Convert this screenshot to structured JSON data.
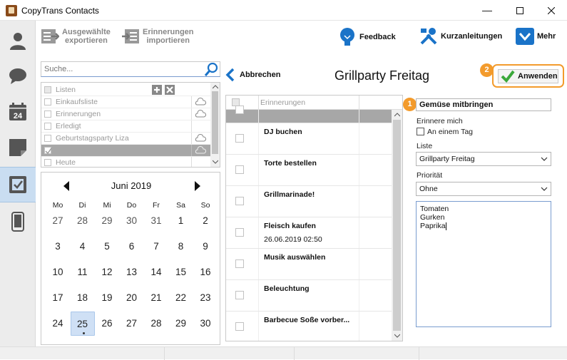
{
  "window": {
    "title": "CopyTrans Contacts",
    "controls": [
      "minimize",
      "maximize",
      "close"
    ]
  },
  "nav": {
    "items": [
      {
        "icon": "contacts-icon"
      },
      {
        "icon": "messages-icon"
      },
      {
        "icon": "calendar-icon",
        "text": "24"
      },
      {
        "icon": "notes-icon"
      },
      {
        "icon": "reminders-icon"
      },
      {
        "icon": "phone-icon"
      }
    ]
  },
  "toolbar": {
    "export": {
      "line1": "Ausgewählte",
      "line2": "exportieren"
    },
    "import": {
      "line1": "Erinnerungen",
      "line2": "importieren"
    },
    "feedback": "Feedback",
    "tutorials": "Kurzanleitungen",
    "more": "Mehr"
  },
  "search": {
    "placeholder": "Suche..."
  },
  "lists": {
    "header": "Listen",
    "items": [
      {
        "label": "Einkaufsliste",
        "cloud": true
      },
      {
        "label": "Erinnerungen",
        "cloud": true
      },
      {
        "label": "Erledigt",
        "cloud": false
      },
      {
        "label": "Geburtstagsparty Liza",
        "cloud": true
      },
      {
        "label": "",
        "cloud": true,
        "checked": true,
        "selected": true
      },
      {
        "label": "Heute",
        "cloud": false
      }
    ]
  },
  "calendar": {
    "month": "Juni 2019",
    "weekdays": [
      "Mo",
      "Di",
      "Mi",
      "Do",
      "Fr",
      "Sa",
      "So"
    ],
    "weeks": [
      [
        "27",
        "28",
        "29",
        "30",
        "31",
        "1",
        "2"
      ],
      [
        "3",
        "4",
        "5",
        "6",
        "7",
        "8",
        "9"
      ],
      [
        "10",
        "11",
        "12",
        "13",
        "14",
        "15",
        "16"
      ],
      [
        "17",
        "18",
        "19",
        "20",
        "21",
        "22",
        "23"
      ],
      [
        "24",
        "25",
        "26",
        "27",
        "28",
        "29",
        "30"
      ]
    ],
    "today": "25"
  },
  "header": {
    "back": "Abbrechen",
    "title": "Grillparty Freitag",
    "apply": "Anwenden",
    "apply_badge": "2",
    "name_badge": "1"
  },
  "reminders": {
    "column": "Erinnerungen",
    "items": [
      {
        "name": "",
        "date": "",
        "selected": true
      },
      {
        "name": "DJ buchen",
        "date": ""
      },
      {
        "name": "Torte bestellen",
        "date": ""
      },
      {
        "name": "Grillmarinade!",
        "date": ""
      },
      {
        "name": "Fleisch kaufen",
        "date": "26.06.2019 02:50"
      },
      {
        "name": "Musik auswählen",
        "date": ""
      },
      {
        "name": "Beleuchtung",
        "date": ""
      },
      {
        "name": "Barbecue Soße vorber...",
        "date": ""
      }
    ]
  },
  "detail": {
    "name": "Gemüse mitbringen",
    "remind_label": "Erinnere mich",
    "on_day_label": "An einem Tag",
    "list_label": "Liste",
    "list_value": "Grillparty Freitag",
    "priority_label": "Priorität",
    "priority_value": "Ohne",
    "notes_lines": [
      "Tomaten",
      "Gurken",
      "Paprika"
    ]
  },
  "colors": {
    "accent": "#f39b2c",
    "selection": "#a7a7a7",
    "nav_active": "#c9ddf1",
    "icon_blue": "#1a73c8"
  }
}
